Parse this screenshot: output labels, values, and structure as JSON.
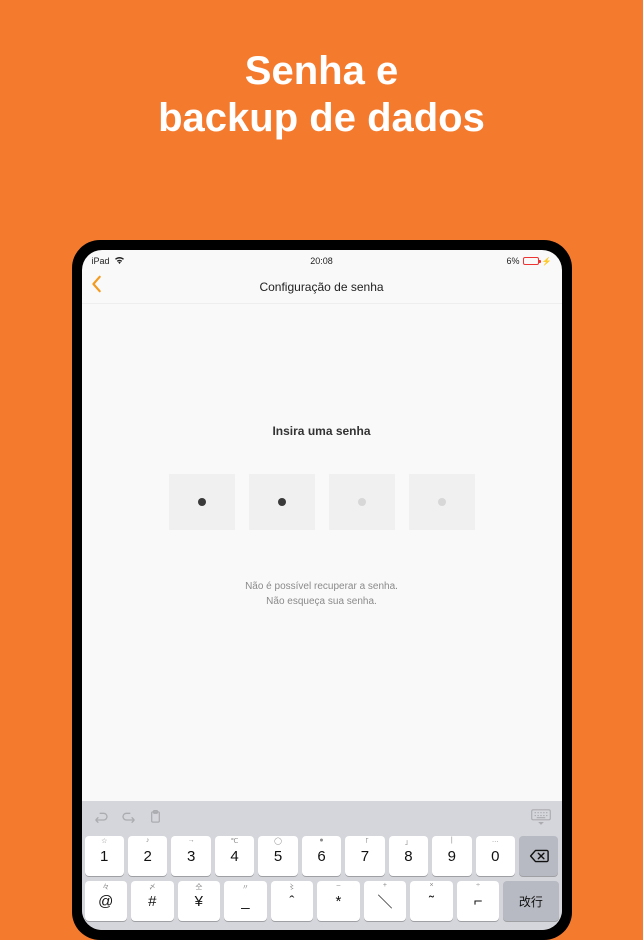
{
  "headline_line1": "Senha e",
  "headline_line2": "backup de dados",
  "statusbar": {
    "device": "iPad",
    "wifi": "wifi-icon",
    "time": "20:08",
    "battery_pct": "6%"
  },
  "navbar": {
    "back_icon": "chevron-left",
    "title": "Configuração de senha"
  },
  "content": {
    "prompt": "Insira uma senha",
    "pin_state": [
      "filled",
      "filled",
      "empty",
      "empty"
    ],
    "hint_line1": "Não é possível recuperar a senha.",
    "hint_line2": "Não esqueça sua senha."
  },
  "keyboard": {
    "row1": [
      {
        "hint": "☆",
        "main": "1"
      },
      {
        "hint": "♪",
        "main": "2"
      },
      {
        "hint": "→",
        "main": "3"
      },
      {
        "hint": "℃",
        "main": "4"
      },
      {
        "hint": "◯",
        "main": "5"
      },
      {
        "hint": "●",
        "main": "6"
      },
      {
        "hint": "「",
        "main": "7"
      },
      {
        "hint": "」",
        "main": "8"
      },
      {
        "hint": "|",
        "main": "9"
      },
      {
        "hint": "…",
        "main": "0"
      }
    ],
    "row2": [
      {
        "hint": "々",
        "main": "@"
      },
      {
        "hint": "〆",
        "main": "#"
      },
      {
        "hint": "仝",
        "main": "¥"
      },
      {
        "hint": "〃",
        "main": "_"
      },
      {
        "hint": "〻",
        "main": "ˆ"
      },
      {
        "hint": "–",
        "main": "*"
      },
      {
        "hint": "+",
        "main": "＼"
      },
      {
        "hint": "×",
        "main": "˜"
      },
      {
        "hint": "÷",
        "main": "⌐"
      },
      {
        "main": "改行",
        "special": true
      }
    ],
    "backspace": "backspace"
  }
}
